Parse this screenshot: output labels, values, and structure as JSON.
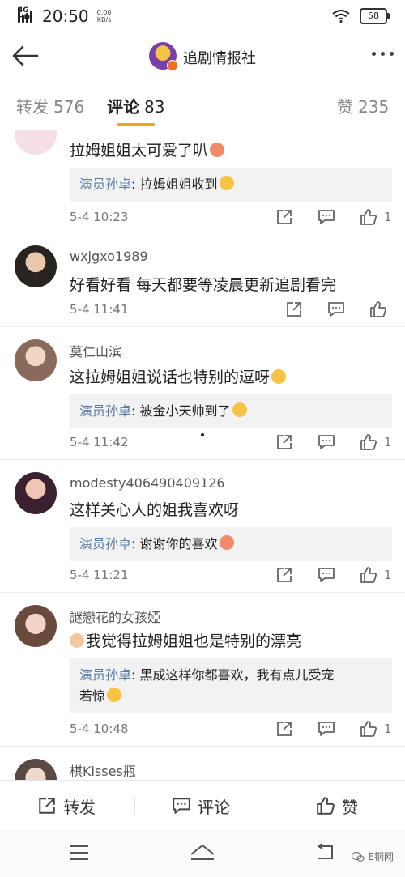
{
  "status_bar": {
    "network": "4G HD",
    "time": "20:50",
    "speed_value": "0.00",
    "speed_unit": "KB/s",
    "battery": "58"
  },
  "header": {
    "account_name": "追剧情报社"
  },
  "tabs": [
    {
      "label": "转发",
      "count": "576"
    },
    {
      "label": "评论",
      "count": "83"
    },
    {
      "label": "赞",
      "count": "235"
    }
  ],
  "comments": [
    {
      "username": "",
      "text": "拉姆姐姐太可爱了叭",
      "reply_author": "演员孙卓",
      "reply_text": "拉姆姐姐收到",
      "time": "5-4 10:23",
      "likes": "1"
    },
    {
      "username": "wxjgxo1989",
      "text": "好看好看 每天都要等凌晨更新追剧看完",
      "time": "5-4 11:41",
      "likes": ""
    },
    {
      "username": "莫仁山滨",
      "text": "这拉姆姐姐说话也特别的逗呀",
      "reply_author": "演员孙卓",
      "reply_text": "被金小天帅到了",
      "time": "5-4 11:42",
      "likes": "1"
    },
    {
      "username": "modesty406490409126",
      "text": "这样关心人的姐我喜欢呀",
      "reply_author": "演员孙卓",
      "reply_text": "谢谢你的喜欢",
      "time": "5-4 11:21",
      "likes": "1"
    },
    {
      "username": "謎戀花的女孩婭",
      "text": "我觉得拉姆姐姐也是特别的漂亮",
      "reply_author": "演员孙卓",
      "reply_text_line1": "黑成这样你都喜欢，我有点儿受宠",
      "reply_text_line2": "若惊",
      "time": "5-4 10:48",
      "likes": "1"
    },
    {
      "username": "棋Kisses瓶"
    }
  ],
  "bottom_bar": {
    "repost": "转发",
    "comment": "评论",
    "like": "赞"
  },
  "watermark": "E铜网",
  "colors": {
    "accent_underline": "#f7a21b",
    "reply_author": "#5b7fa8",
    "reply_bg": "#f2f2f2"
  }
}
